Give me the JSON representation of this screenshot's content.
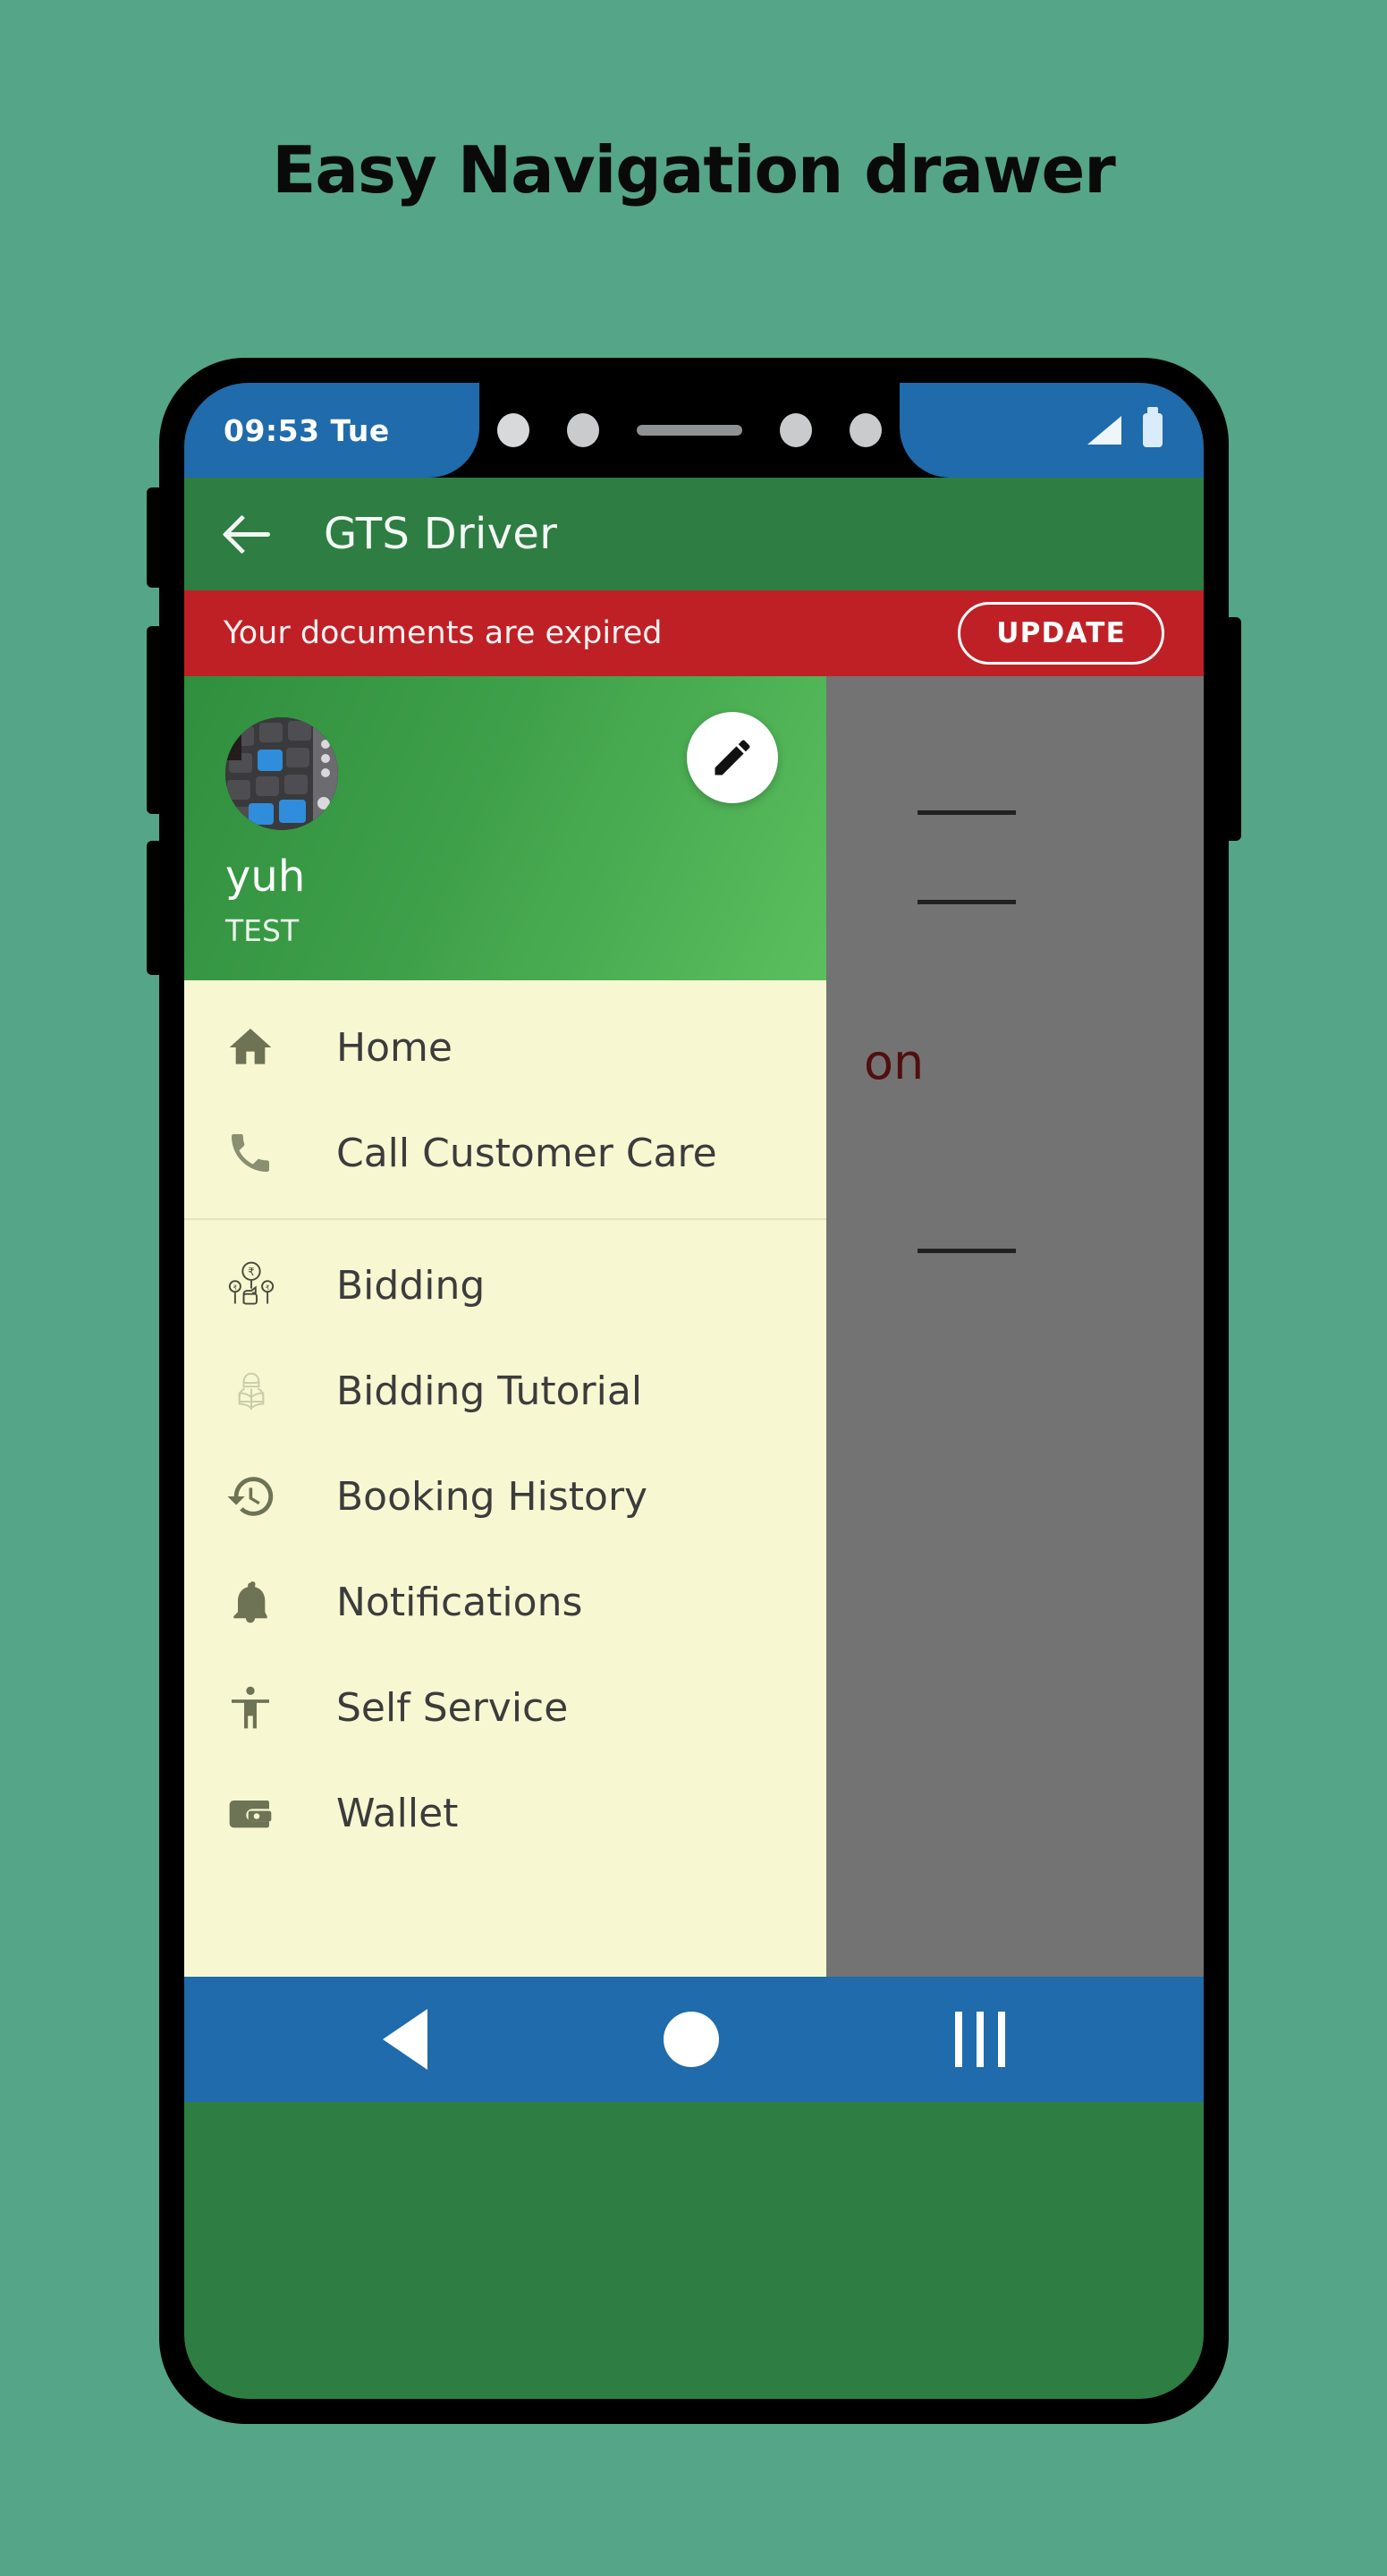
{
  "promo": {
    "title": "Easy Navigation drawer"
  },
  "colors": {
    "page_background": "#55a588",
    "status_bar": "#1f6bab",
    "app_bar": "#2e7d43",
    "alert_banner": "#bf2026",
    "drawer_background": "#f7f8d2",
    "drawer_header_gradient_start": "#2f8f3e",
    "drawer_header_gradient_end": "#5bbf5e",
    "nav_bar": "#1f6bab",
    "menu_icon": "#6e7356",
    "menu_label": "#3c3c3c"
  },
  "status_bar": {
    "time": "09:53 Tue",
    "signal_icon": "signal-triangle-icon",
    "battery_icon": "battery-icon"
  },
  "app_bar": {
    "back_icon": "back-arrow-icon",
    "title": "GTS Driver"
  },
  "alert_banner": {
    "message": "Your documents are expired",
    "action_label": "UPDATE"
  },
  "background_content": {
    "partial_text": "on"
  },
  "drawer": {
    "header": {
      "avatar_icon": "user-avatar-keyboard-photo",
      "edit_icon": "pencil-edit-icon",
      "name": "yuh",
      "subtitle": "TEST"
    },
    "menu_groups": [
      {
        "items": [
          {
            "label": "Home",
            "icon": "home-icon"
          },
          {
            "label": "Call Customer Care",
            "icon": "phone-icon"
          }
        ]
      },
      {
        "items": [
          {
            "label": "Bidding",
            "icon": "rupee-bidding-icon"
          },
          {
            "label": "Bidding Tutorial",
            "icon": "person-reading-icon"
          },
          {
            "label": "Booking History",
            "icon": "history-clock-icon"
          },
          {
            "label": "Notifications",
            "icon": "bell-icon"
          },
          {
            "label": "Self Service",
            "icon": "accessibility-person-icon"
          },
          {
            "label": "Wallet",
            "icon": "wallet-icon"
          }
        ]
      }
    ]
  },
  "nav_bar": {
    "back_label": "back-triangle-icon",
    "home_label": "home-circle-icon",
    "recents_label": "recents-bars-icon"
  }
}
